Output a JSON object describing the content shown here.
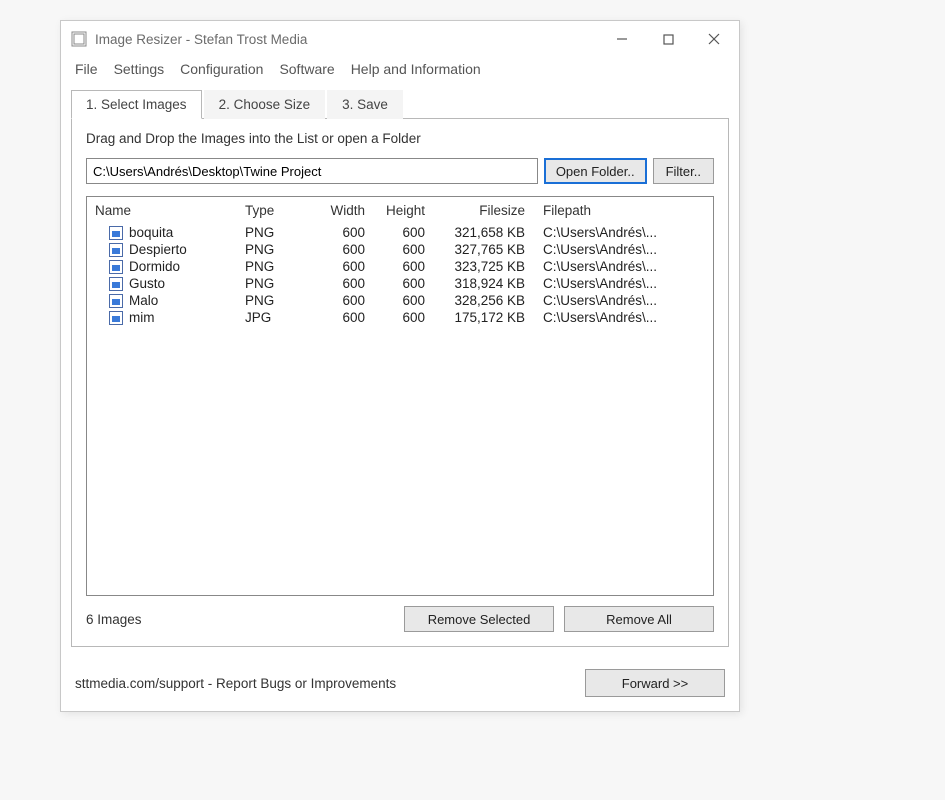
{
  "window": {
    "title": "Image Resizer - Stefan Trost Media"
  },
  "menu": {
    "file": "File",
    "settings": "Settings",
    "configuration": "Configuration",
    "software": "Software",
    "help": "Help and Information"
  },
  "tabs": {
    "t1": "1. Select Images",
    "t2": "2. Choose Size",
    "t3": "3. Save"
  },
  "panel": {
    "hint": "Drag and Drop the Images into the List or open a Folder"
  },
  "path": {
    "value": "C:\\Users\\Andrés\\Desktop\\Twine Project",
    "open_folder": "Open Folder..",
    "filter": "Filter.."
  },
  "columns": {
    "name": "Name",
    "type": "Type",
    "width": "Width",
    "height": "Height",
    "filesize": "Filesize",
    "filepath": "Filepath"
  },
  "rows": [
    {
      "name": "boquita",
      "type": "PNG",
      "width": "600",
      "height": "600",
      "filesize": "321,658 KB",
      "filepath": "C:\\Users\\Andrés\\..."
    },
    {
      "name": "Despierto",
      "type": "PNG",
      "width": "600",
      "height": "600",
      "filesize": "327,765 KB",
      "filepath": "C:\\Users\\Andrés\\..."
    },
    {
      "name": "Dormido",
      "type": "PNG",
      "width": "600",
      "height": "600",
      "filesize": "323,725 KB",
      "filepath": "C:\\Users\\Andrés\\..."
    },
    {
      "name": "Gusto",
      "type": "PNG",
      "width": "600",
      "height": "600",
      "filesize": "318,924 KB",
      "filepath": "C:\\Users\\Andrés\\..."
    },
    {
      "name": "Malo",
      "type": "PNG",
      "width": "600",
      "height": "600",
      "filesize": "328,256 KB",
      "filepath": "C:\\Users\\Andrés\\..."
    },
    {
      "name": "mim",
      "type": "JPG",
      "width": "600",
      "height": "600",
      "filesize": "175,172 KB",
      "filepath": "C:\\Users\\Andrés\\..."
    }
  ],
  "status": {
    "count": "6 Images",
    "remove_selected": "Remove Selected",
    "remove_all": "Remove All"
  },
  "footer": {
    "link": "sttmedia.com/support - Report Bugs or Improvements",
    "forward": "Forward >>"
  }
}
